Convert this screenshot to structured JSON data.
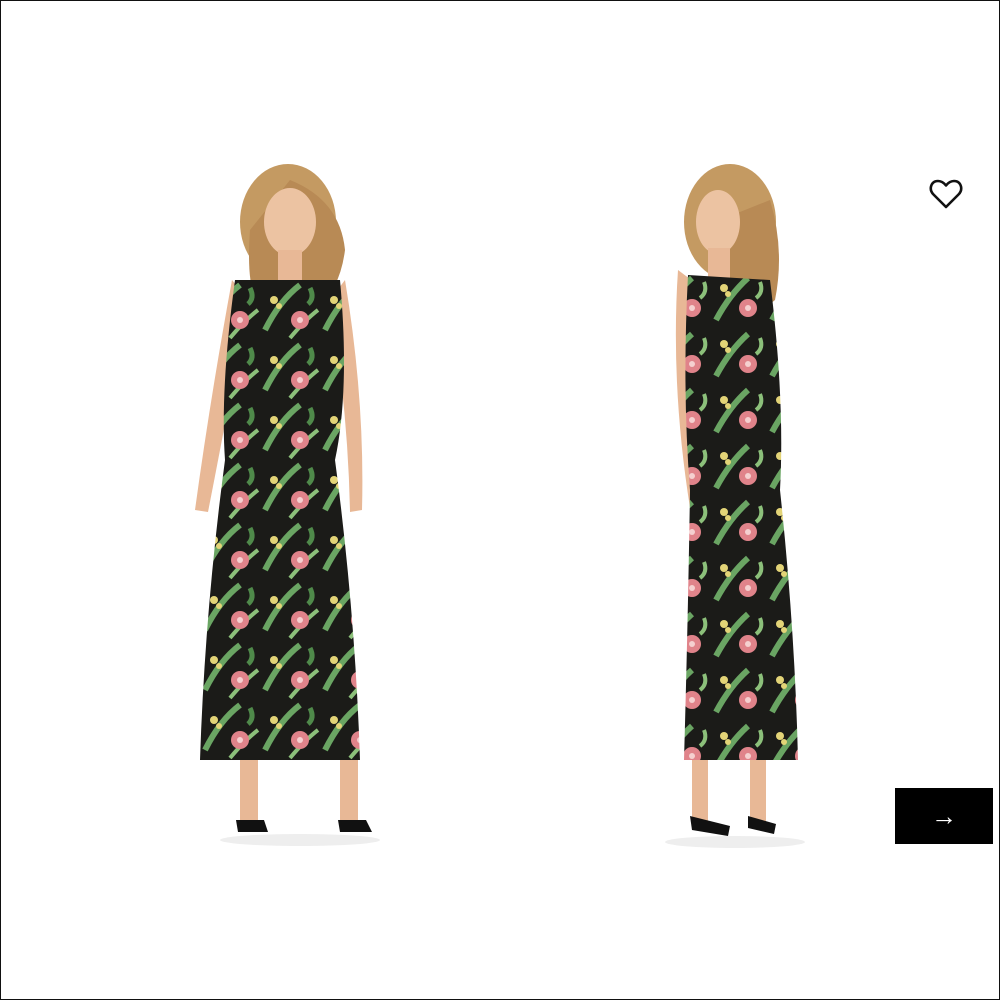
{
  "viewer": {
    "images": [
      {
        "alt": "front-view",
        "view": "front"
      },
      {
        "alt": "side-view",
        "view": "side"
      }
    ],
    "wishlist_icon": "heart-outline-icon",
    "next_icon": "arrow-right-icon",
    "next_glyph": "→"
  },
  "colors": {
    "background": "#ffffff",
    "button_bg": "#000000",
    "dress_base": "#1b1b18",
    "leaf": "#5f9a5a",
    "flower": "#e0838a",
    "yellow": "#e3d477",
    "skin": "#e8b896",
    "hair": "#c49a62"
  }
}
